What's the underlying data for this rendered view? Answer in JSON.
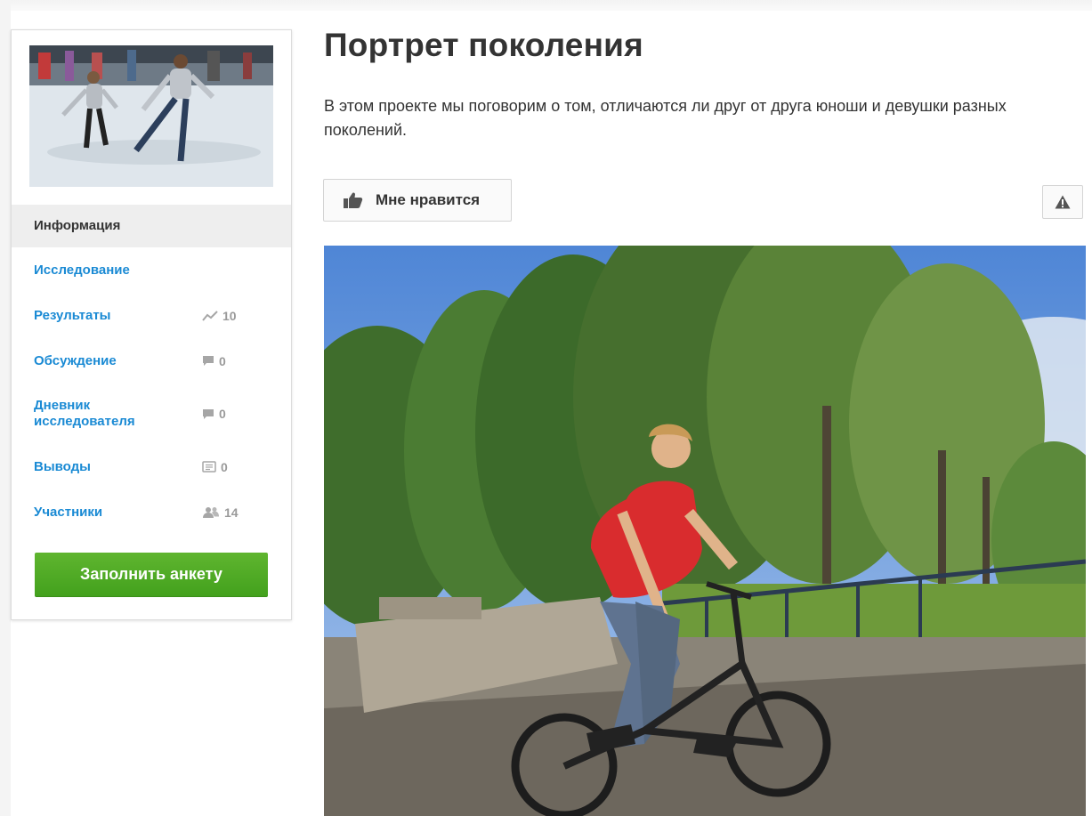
{
  "project": {
    "title": "Портрет поколения",
    "description": "В этом проекте мы поговорим о том, отличаются ли друг от друга юноши и девушки разных поколений."
  },
  "actions": {
    "like_label": "Мне нравится",
    "report_icon": "warning-icon",
    "like_icon": "thumbs-up-icon"
  },
  "sidebar": {
    "items": [
      {
        "label": "Информация",
        "active": true
      },
      {
        "label": "Исследование"
      },
      {
        "label": "Результаты",
        "count": "10",
        "icon": "chart-icon"
      },
      {
        "label": "Обсуждение",
        "count": "0",
        "icon": "comment-icon"
      },
      {
        "label": "Дневник исследователя",
        "count": "0",
        "icon": "comment-icon"
      },
      {
        "label": "Выводы",
        "count": "0",
        "icon": "document-icon"
      },
      {
        "label": "Участники",
        "count": "14",
        "icon": "users-icon"
      }
    ],
    "cta_label": "Заполнить анкету"
  },
  "colors": {
    "link": "#1a8ad4",
    "cta": "#4fa924",
    "muted": "#9a9a9a"
  }
}
